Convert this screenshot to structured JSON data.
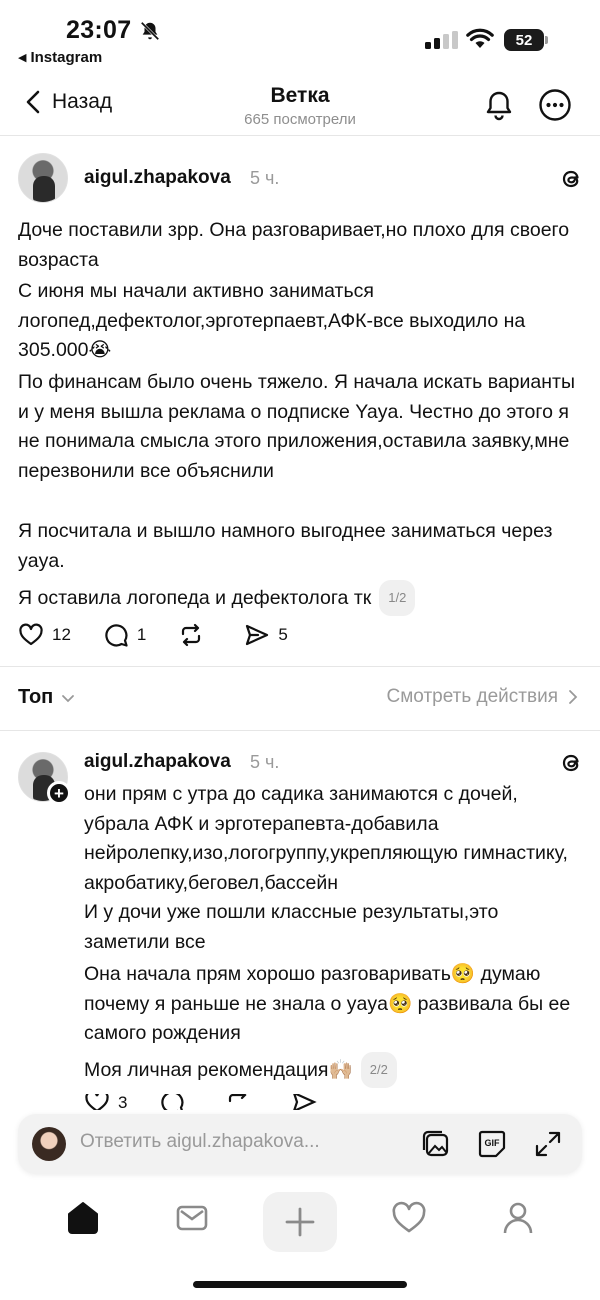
{
  "status_bar": {
    "time": "23:07",
    "back_app": "Instagram",
    "battery": "52",
    "battery_level": 0.52
  },
  "nav": {
    "back_label": "Назад",
    "title": "Ветка",
    "subtitle": "665 посмотрели"
  },
  "post": {
    "username": "aigul.zhapakova",
    "time_ago": "5 ч.",
    "paragraphs": [
      "Доче поставили зрр. Она разговаривает,но плохо для своего возраста",
      "С июня мы начали активно заниматься логопед,дефектолог,эрготерпаевт,АФК-все выходило на 305.000😭",
      "По финансам было очень тяжело. Я начала искать варианты и у меня вышла реклама о подписке Yaya. Честно до этого я не понимала смысла этого приложения,оставила заявку,мне перезвонили все объяснили",
      "Я посчитала и вышло намного выгоднее заниматься через yaya.",
      "Я оставила логопеда и дефектолога тк"
    ],
    "pager": "1/2",
    "likes": "12",
    "comments": "1",
    "shares": "5"
  },
  "sort": {
    "label": "Топ",
    "see_actions": "Смотреть действия"
  },
  "reply": {
    "username": "aigul.zhapakova",
    "time_ago": "5 ч.",
    "paragraphs": [
      "они прям с утра до садика занимаются с дочей, убрала АФК и эрготерапевта-добавила нейролепку,изо,логогруппу,укрепляющую гимнастику, акробатику,беговел,бассейн",
      "И у дочи уже пошли классные результаты,это заметили все",
      "Она начала прям хорошо разговаривать🥺 думаю почему я раньше не знала о yaya🥺 развивала бы ее самого рождения",
      "Моя личная рекомендация🙌🏼"
    ],
    "pager": "2/2",
    "likes": "3"
  },
  "reply_bar": {
    "placeholder": "Ответить aigul.zhapakova..."
  },
  "icons": {
    "tabs": [
      "home-icon",
      "inbox-icon",
      "plus-icon",
      "heart-icon",
      "profile-icon"
    ],
    "reply_bar": [
      "gallery-icon",
      "gif-icon",
      "expand-icon"
    ]
  }
}
